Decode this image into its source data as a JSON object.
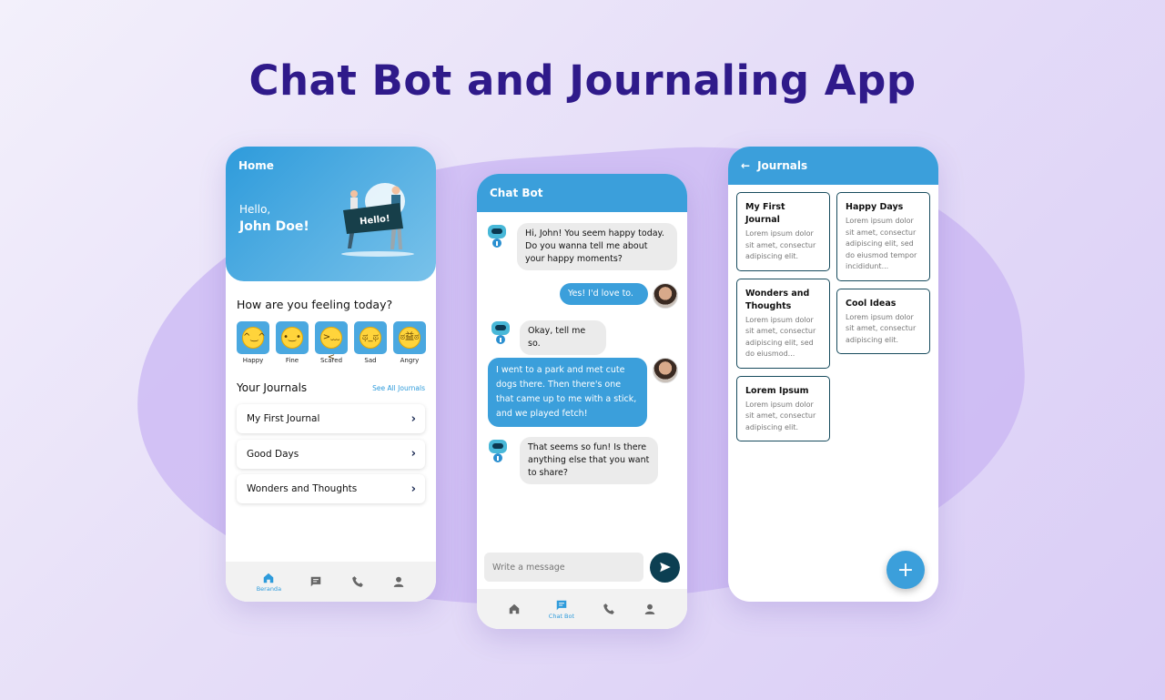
{
  "page_title": "Chat Bot and Journaling App",
  "home": {
    "title": "Home",
    "hello": "Hello,",
    "username": "John Doe!",
    "illustration_text": "Hello!",
    "feeling_question": "How are you feeling today?",
    "moods": [
      {
        "label": "Happy",
        "face": "^‿^"
      },
      {
        "label": "Fine",
        "face": "•‿•"
      },
      {
        "label": "Scared",
        "face": ">﹏<"
      },
      {
        "label": "Sad",
        "face": "ಥ_ಥ"
      },
      {
        "label": "Angry",
        "face": "ಠ益ಠ"
      }
    ],
    "journals_title": "Your Journals",
    "see_all": "See All Journals",
    "journals": [
      "My First Journal",
      "Good Days",
      "Wonders and Thoughts"
    ],
    "nav": {
      "home_label": "Beranda"
    }
  },
  "chat": {
    "title": "Chat Bot",
    "messages": [
      {
        "from": "bot",
        "text": "Hi, John! You seem happy today. Do you wanna tell me about your happy moments?"
      },
      {
        "from": "user",
        "text": "Yes! I'd love to."
      },
      {
        "from": "bot",
        "text": "Okay, tell me so."
      },
      {
        "from": "user",
        "text": "I went to a park and met cute dogs there. Then there's one that came up to me with a stick, and we played fetch!"
      },
      {
        "from": "bot",
        "text": "That seems so fun! Is there anything else that you want to share?"
      }
    ],
    "input_placeholder": "Write a message",
    "nav": {
      "chat_label": "Chat Bot"
    }
  },
  "journals_page": {
    "title": "Journals",
    "left_col": [
      {
        "title": "My First Journal",
        "body": "Lorem ipsum dolor sit amet, consectur adipiscing elit."
      },
      {
        "title": "Wonders and Thoughts",
        "body": "Lorem ipsum dolor sit amet, consectur adipiscing elit, sed do eiusmod..."
      },
      {
        "title": "Lorem Ipsum",
        "body": "Lorem ipsum dolor sit amet, consectur adipiscing elit."
      }
    ],
    "right_col": [
      {
        "title": "Happy Days",
        "body": "Lorem ipsum dolor sit amet, consectur adipiscing elit, sed do eiusmod tempor incididunt..."
      },
      {
        "title": "Cool Ideas",
        "body": "Lorem ipsum dolor sit amet, consectur adipiscing elit."
      }
    ],
    "fab_symbol": "+"
  },
  "colors": {
    "title": "#2f1a8a",
    "primary": "#3b9fdb",
    "send_button": "#0c3f52",
    "mood_tile": "#4aa8e0"
  }
}
